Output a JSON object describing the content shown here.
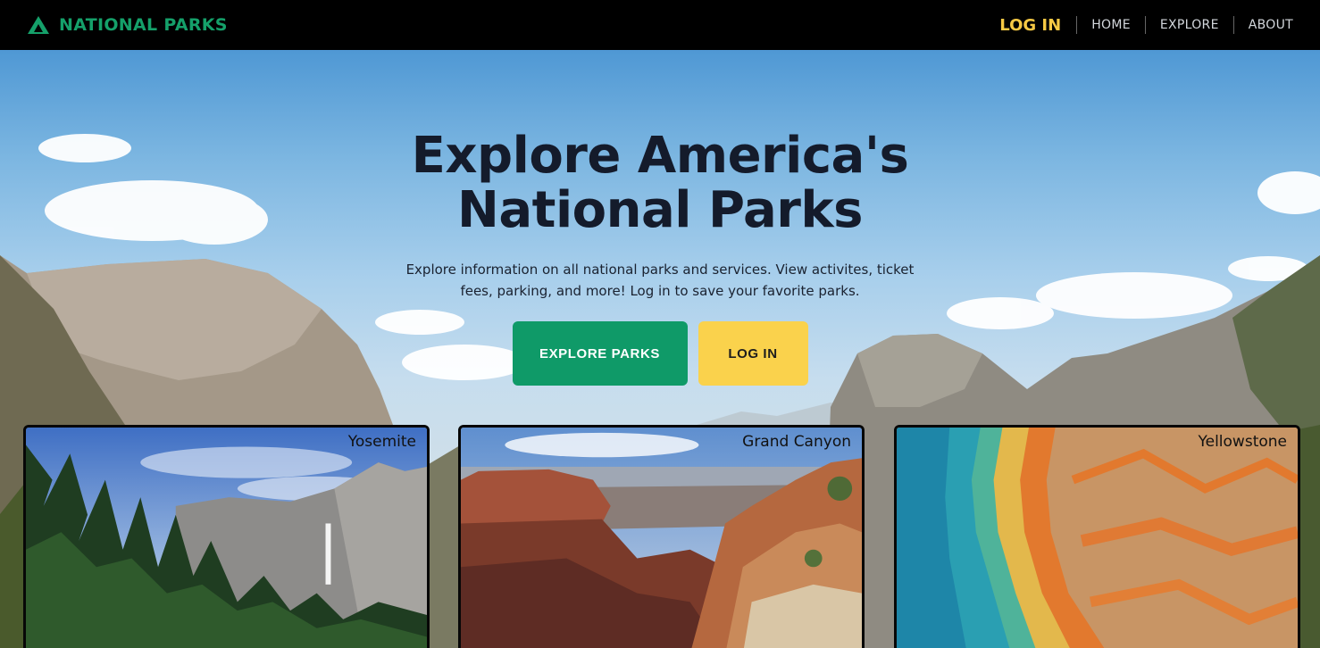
{
  "navbar": {
    "brand": "NATIONAL PARKS",
    "brand_icon": "mountain-icon",
    "login": "LOG IN",
    "links": [
      "HOME",
      "EXPLORE",
      "ABOUT"
    ]
  },
  "hero": {
    "title_line1": "Explore America's",
    "title_line2": "National Parks",
    "subtitle": "Explore information on all national parks and services. View activites, ticket fees, parking, and more! Log in to save your favorite parks.",
    "explore_button": "EXPLORE PARKS",
    "login_button": "LOG IN"
  },
  "cards": [
    {
      "name": "Yosemite"
    },
    {
      "name": "Grand Canyon"
    },
    {
      "name": "Yellowstone"
    }
  ],
  "colors": {
    "brand": "#15a06a",
    "login_accent": "#f6c944",
    "explore_button": "#0f9a68",
    "login_button": "#fad24c",
    "title": "#141b2b"
  }
}
